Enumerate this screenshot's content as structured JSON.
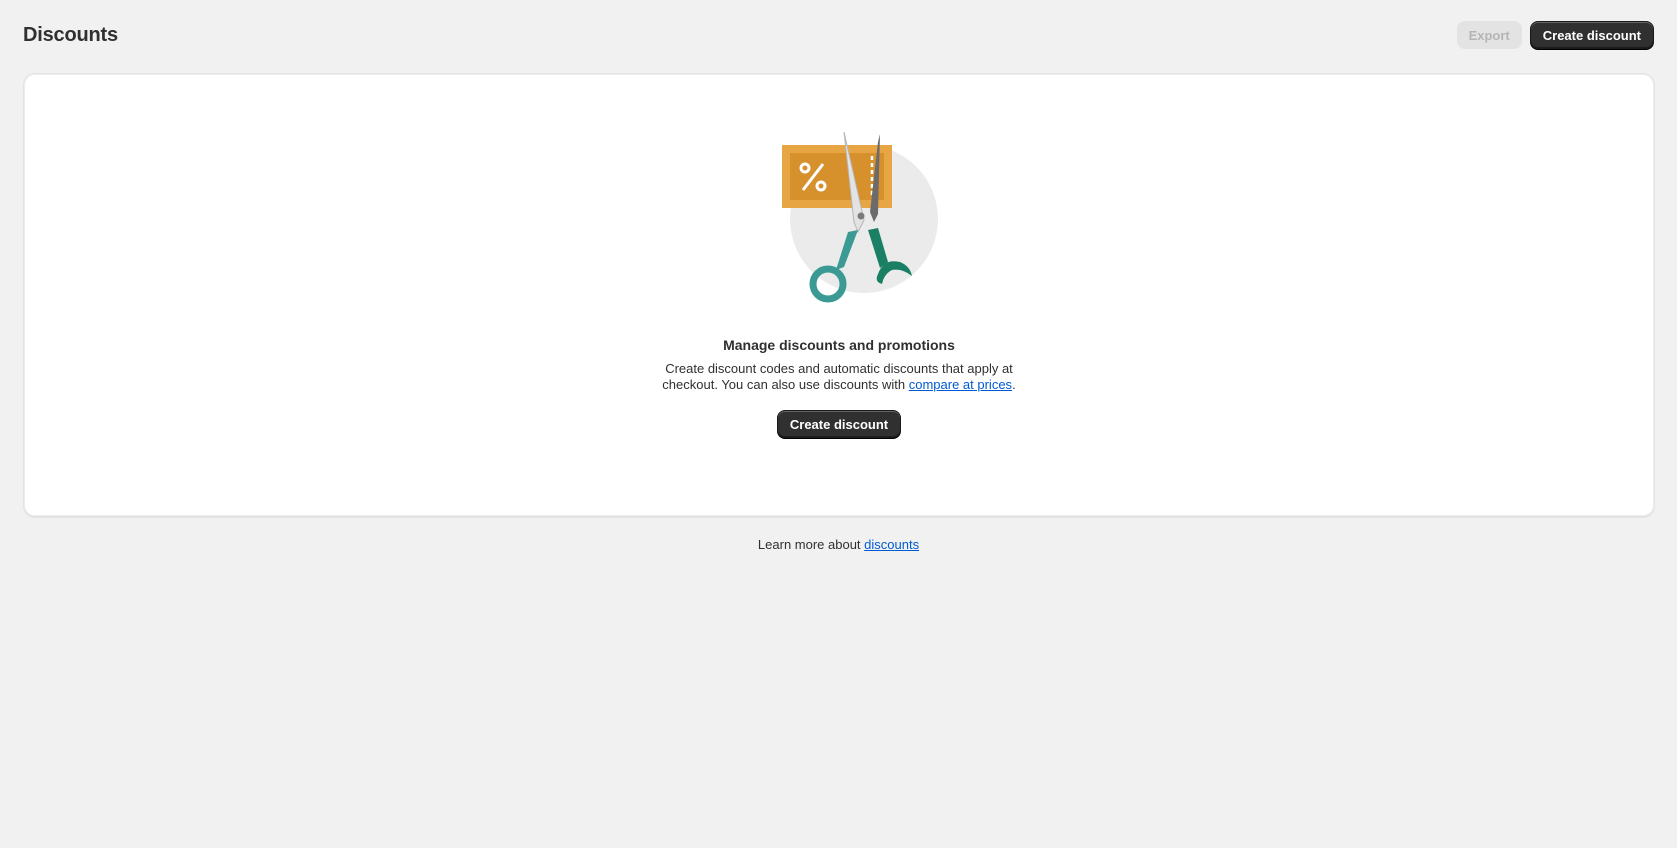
{
  "header": {
    "title": "Discounts",
    "export_label": "Export",
    "create_label": "Create discount"
  },
  "empty_state": {
    "illustration_icon": "scissors-cutting-coupon-icon",
    "heading": "Manage discounts and promotions",
    "body_line1": "Create discount codes and automatic discounts that apply at",
    "body_line2_prefix": "checkout. You can also use discounts with ",
    "body_link": "compare at prices",
    "body_line2_suffix": ".",
    "action_label": "Create discount"
  },
  "footer": {
    "prefix": "Learn more about ",
    "link": "discounts"
  },
  "colors": {
    "background": "#f1f1f1",
    "primary_button": "#303030",
    "link": "#005bd3",
    "coupon": "#e8a544",
    "scissors_handle_left": "#3c9a94",
    "scissors_handle_right": "#1a7f64"
  }
}
